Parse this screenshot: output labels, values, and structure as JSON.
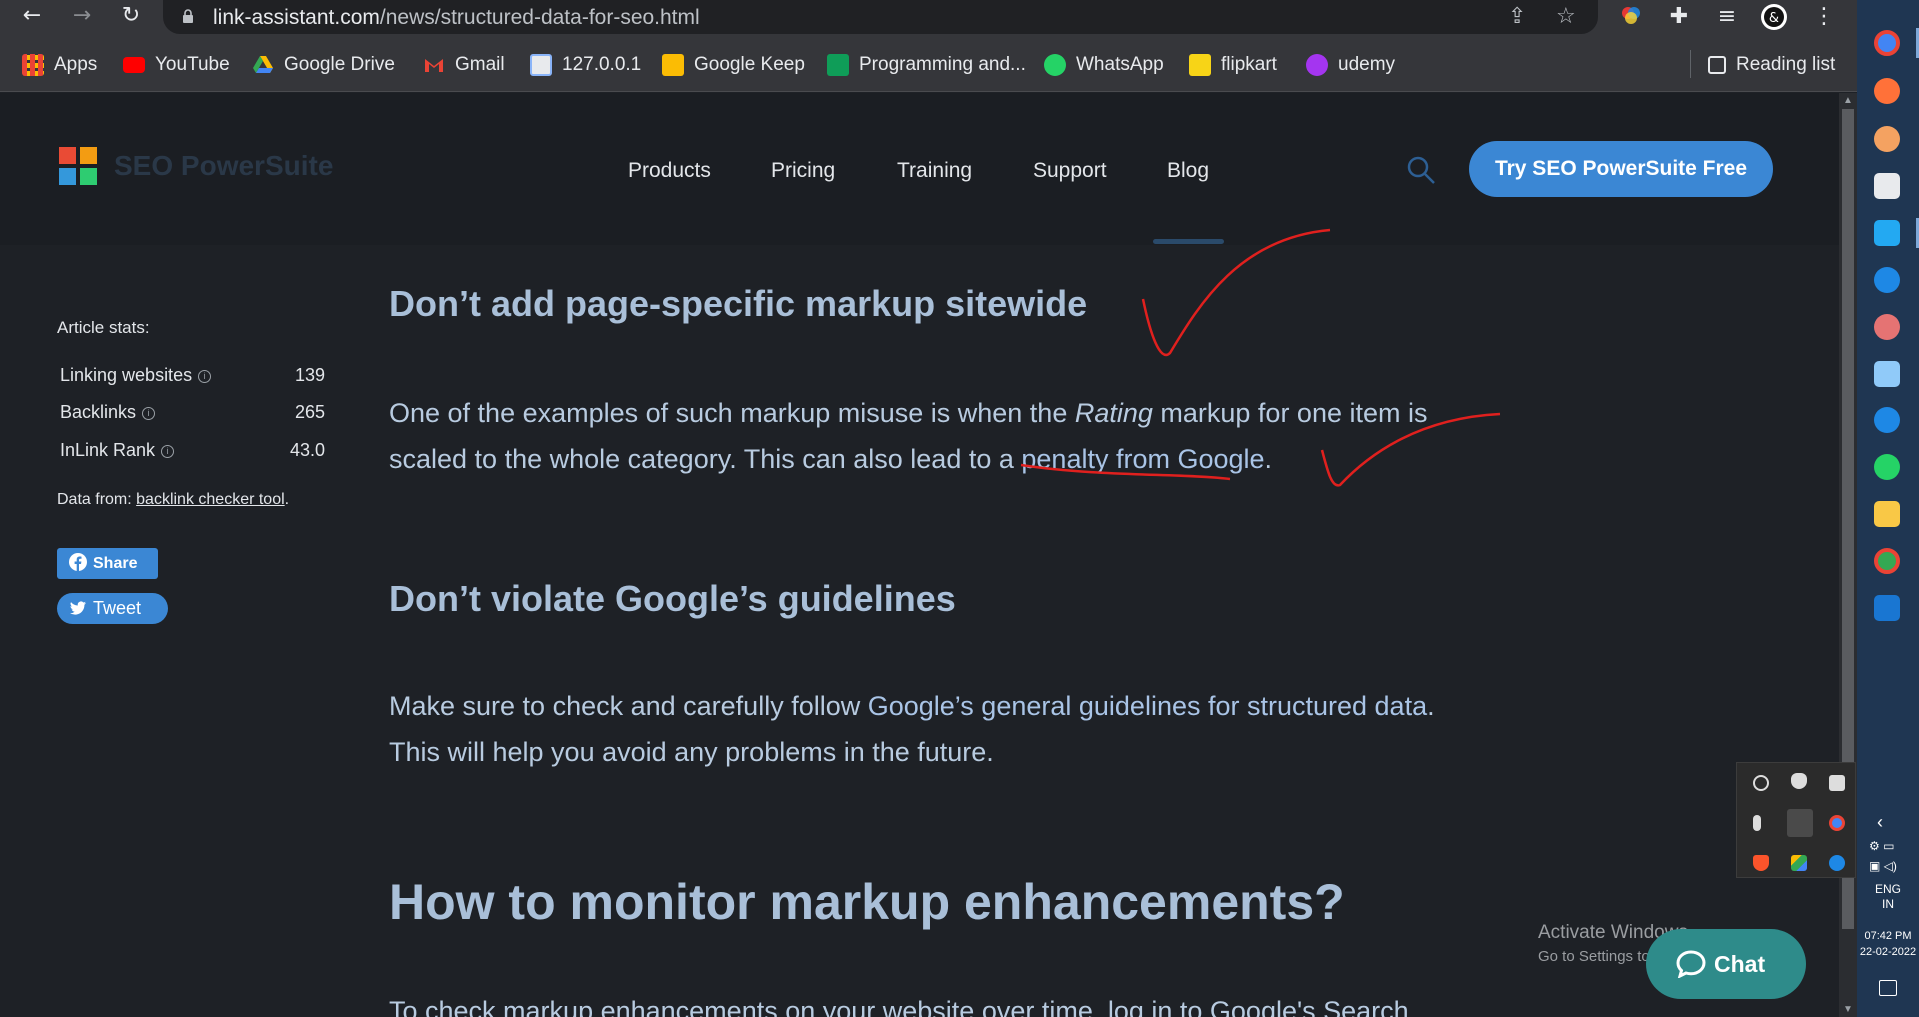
{
  "browser": {
    "url_host": "link-assistant.com",
    "url_path": "/news/structured-data-for-seo.html",
    "bookmarks": [
      {
        "label": "Apps",
        "color": "#ea4335"
      },
      {
        "label": "YouTube",
        "color": "#ff0000"
      },
      {
        "label": "Google Drive",
        "color": "#34a853"
      },
      {
        "label": "Gmail",
        "color": "#ea4335"
      },
      {
        "label": "127.0.0.1",
        "color": "#8ab4f8"
      },
      {
        "label": "Google Keep",
        "color": "#fbbc04"
      },
      {
        "label": "Programming and...",
        "color": "#0f9d58"
      },
      {
        "label": "WhatsApp",
        "color": "#25d366"
      },
      {
        "label": "flipkart",
        "color": "#f7d417"
      },
      {
        "label": "udemy",
        "color": "#a435f0"
      }
    ],
    "reading_list": "Reading list"
  },
  "site": {
    "logo_text": "SEO PowerSuite",
    "nav": [
      "Products",
      "Pricing",
      "Training",
      "Support",
      "Blog"
    ],
    "cta": "Try SEO PowerSuite Free"
  },
  "sidebar": {
    "stats_title": "Article stats:",
    "stats": [
      {
        "label": "Linking websites",
        "value": "139"
      },
      {
        "label": "Backlinks",
        "value": "265"
      },
      {
        "label": "InLink Rank",
        "value": "43.0"
      }
    ],
    "data_from_prefix": "Data from: ",
    "data_from_link": "backlink checker tool",
    "data_from_suffix": ".",
    "share": "Share",
    "tweet": "Tweet"
  },
  "article": {
    "h3_1": "Don’t add page-specific markup sitewide",
    "p1_a": "One of the examples of such markup misuse is when the ",
    "p1_em": "Rating",
    "p1_b": " markup for one item is scaled to the whole category. This can also lead to a ",
    "p1_link": "penalty from Google",
    "p1_c": ".",
    "h3_2": "Don’t violate Google’s guidelines",
    "p2_a": "Make sure to check and carefully follow ",
    "p2_link": "Google’s general guidelines for structured data",
    "p2_b": ". This will help you avoid any problems in the future.",
    "h2": "How to monitor markup enhancements?",
    "p3": "To check markup enhancements on your website over time, log in to Google's Search"
  },
  "overlay": {
    "activate_title": "Activate Windows",
    "activate_sub": "Go to Settings to activate Windows.",
    "chat": "Chat"
  },
  "taskbar": {
    "lang1": "ENG",
    "lang2": "IN",
    "time": "07:42 PM",
    "date": "22-02-2022"
  }
}
